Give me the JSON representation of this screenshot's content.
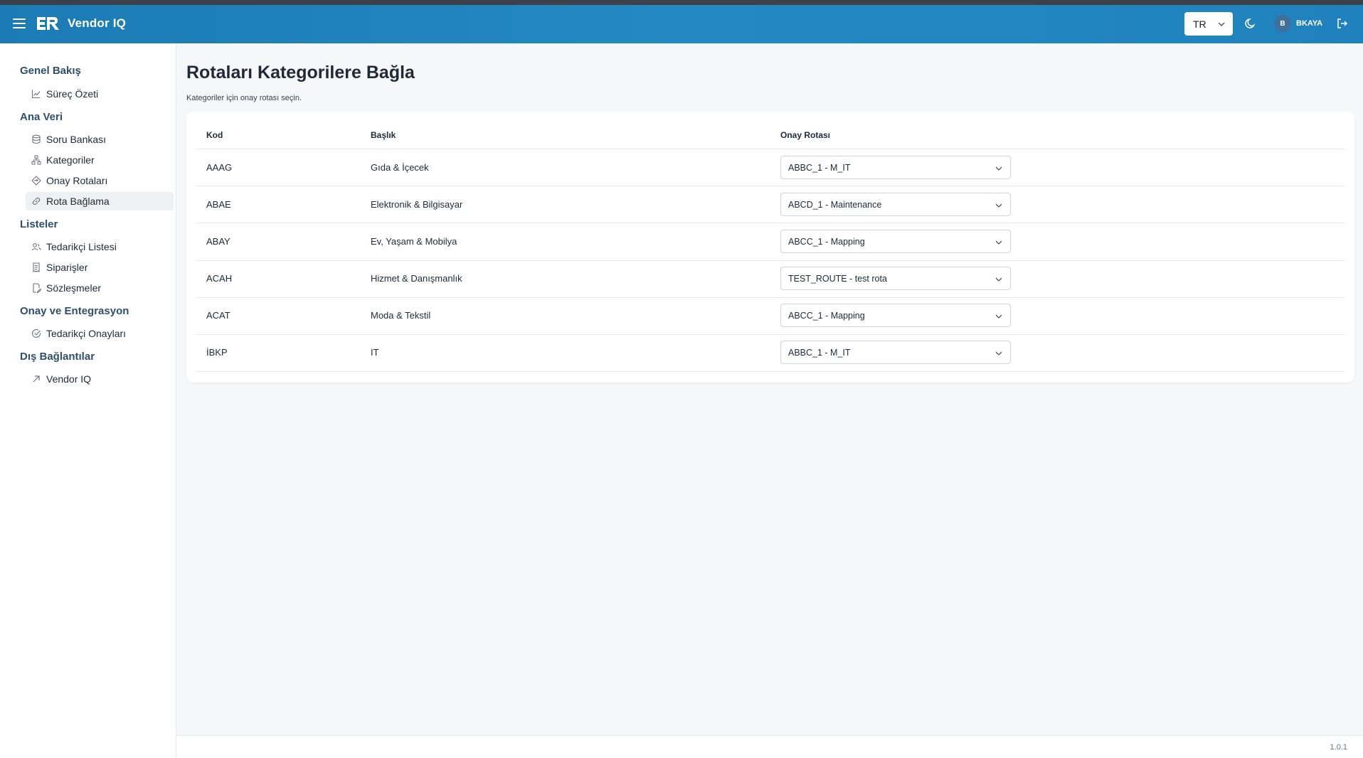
{
  "header": {
    "app_title": "Vendor IQ",
    "language": "TR",
    "avatar_initial": "B",
    "username": "BKAYA"
  },
  "sidebar": {
    "groups": [
      {
        "label": "Genel Bakış",
        "items": [
          {
            "label": "Süreç Özeti",
            "icon": "chart-line-icon"
          }
        ]
      },
      {
        "label": "Ana Veri",
        "items": [
          {
            "label": "Soru Bankası",
            "icon": "database-icon"
          },
          {
            "label": "Kategoriler",
            "icon": "hierarchy-icon"
          },
          {
            "label": "Onay Rotaları",
            "icon": "route-diamond-icon"
          },
          {
            "label": "Rota Bağlama",
            "icon": "link-icon",
            "active": true
          }
        ]
      },
      {
        "label": "Listeler",
        "items": [
          {
            "label": "Tedarikçi Listesi",
            "icon": "users-icon"
          },
          {
            "label": "Siparişler",
            "icon": "receipt-icon"
          },
          {
            "label": "Sözleşmeler",
            "icon": "document-edit-icon"
          }
        ]
      },
      {
        "label": "Onay ve Entegrasyon",
        "items": [
          {
            "label": "Tedarikçi Onayları",
            "icon": "check-circle-icon"
          }
        ]
      },
      {
        "label": "Dış Bağlantılar",
        "items": [
          {
            "label": "Vendor IQ",
            "icon": "external-arrow-icon"
          }
        ]
      }
    ]
  },
  "main": {
    "title": "Rotaları Kategorilere Bağla",
    "subtitle": "Kategoriler için onay rotası seçin.",
    "columns": [
      "Kod",
      "Başlık",
      "Onay Rotası"
    ],
    "rows": [
      {
        "code": "AAAG",
        "title": "Gıda & İçecek",
        "route": "ABBC_1 - M_IT"
      },
      {
        "code": "ABAE",
        "title": "Elektronik & Bilgisayar",
        "route": "ABCD_1 - Maintenance"
      },
      {
        "code": "ABAY",
        "title": "Ev, Yaşam & Mobilya",
        "route": "ABCC_1 - Mapping"
      },
      {
        "code": "ACAH",
        "title": "Hizmet & Danışmanlık",
        "route": "TEST_ROUTE - test rota"
      },
      {
        "code": "ACAT",
        "title": "Moda & Tekstil",
        "route": "ABCC_1 - Mapping"
      },
      {
        "code": "İBKP",
        "title": "IT",
        "route": "ABBC_1 - M_IT"
      }
    ]
  },
  "footer": {
    "version": "1.0.1"
  },
  "colors": {
    "header": "#1f82bd",
    "accent": "#2f4f6f",
    "active_bg": "#eef1f4"
  }
}
